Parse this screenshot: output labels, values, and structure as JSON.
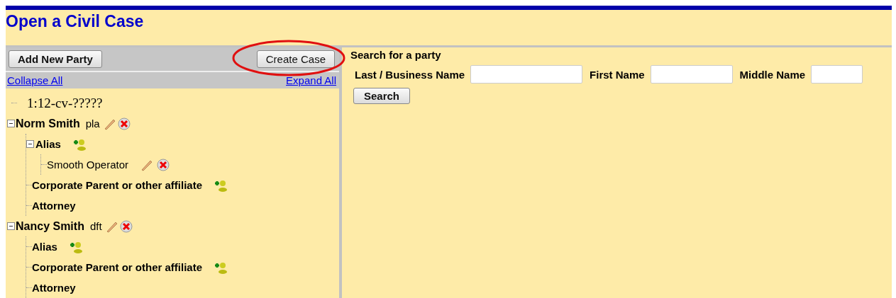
{
  "title": "Open a Civil Case",
  "toolbar": {
    "buttons": [
      "Add New Party",
      "Create Case"
    ],
    "links": [
      "Collapse All",
      "Expand All"
    ]
  },
  "tree": {
    "case_number": "1:12-cv-?????",
    "parties": [
      {
        "name": "Norm Smith",
        "role": "pla",
        "expanded": true,
        "groups": [
          {
            "label": "Alias",
            "addable": true,
            "entries": [
              "Smooth Operator"
            ]
          },
          {
            "label": "Corporate Parent or other affiliate",
            "addable": true
          },
          {
            "label": "Attorney",
            "addable": false
          }
        ]
      },
      {
        "name": "Nancy Smith",
        "role": "dft",
        "expanded": true,
        "groups": [
          {
            "label": "Alias",
            "addable": true
          },
          {
            "label": "Corporate Parent or other affiliate",
            "addable": true
          },
          {
            "label": "Attorney",
            "addable": false
          }
        ]
      }
    ]
  },
  "search": {
    "heading": "Search for a party",
    "fields": [
      {
        "label": "Last / Business Name"
      },
      {
        "label": "First Name"
      },
      {
        "label": "Middle Name"
      }
    ],
    "button": "Search"
  }
}
